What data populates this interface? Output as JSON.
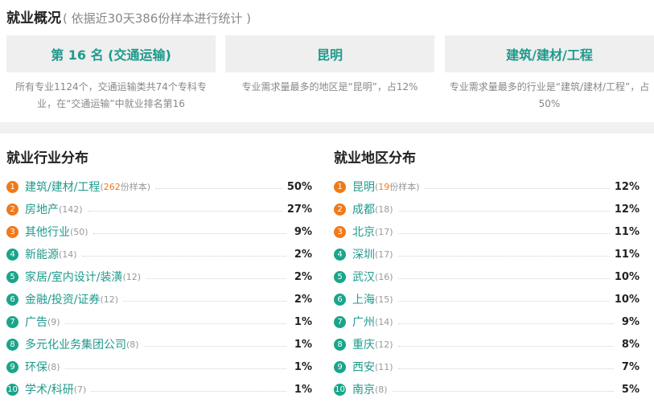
{
  "header": {
    "title": "就业概况",
    "subtitle": "( 依据近30天386份样本进行统计 )"
  },
  "cards": [
    {
      "value": "第 16 名 (交通运输)",
      "desc": "所有专业1124个，交通运输类共74个专科专业，在“交通运输”中就业排名第16"
    },
    {
      "value": "昆明",
      "desc": "专业需求量最多的地区是“昆明”，占12%"
    },
    {
      "value": "建筑/建材/工程",
      "desc": "专业需求量最多的行业是“建筑/建材/工程”，占50%"
    }
  ],
  "industry": {
    "title": "就业行业分布",
    "items": [
      {
        "rank": "1",
        "name": "建筑/建材/工程",
        "count": "262",
        "suffix": "份样本",
        "pct": "50%"
      },
      {
        "rank": "2",
        "name": "房地产",
        "count": "142",
        "suffix": "",
        "pct": "27%"
      },
      {
        "rank": "3",
        "name": "其他行业",
        "count": "50",
        "suffix": "",
        "pct": "9%"
      },
      {
        "rank": "4",
        "name": "新能源",
        "count": "14",
        "suffix": "",
        "pct": "2%"
      },
      {
        "rank": "5",
        "name": "家居/室内设计/装潢",
        "count": "12",
        "suffix": "",
        "pct": "2%"
      },
      {
        "rank": "6",
        "name": "金融/投资/证券",
        "count": "12",
        "suffix": "",
        "pct": "2%"
      },
      {
        "rank": "7",
        "name": "广告",
        "count": "9",
        "suffix": "",
        "pct": "1%"
      },
      {
        "rank": "8",
        "name": "多元化业务集团公司",
        "count": "8",
        "suffix": "",
        "pct": "1%"
      },
      {
        "rank": "9",
        "name": "环保",
        "count": "8",
        "suffix": "",
        "pct": "1%"
      },
      {
        "rank": "10",
        "name": "学术/科研",
        "count": "7",
        "suffix": "",
        "pct": "1%"
      }
    ]
  },
  "region": {
    "title": "就业地区分布",
    "items": [
      {
        "rank": "1",
        "name": "昆明",
        "count": "19",
        "suffix": "份样本",
        "pct": "12%"
      },
      {
        "rank": "2",
        "name": "成都",
        "count": "18",
        "suffix": "",
        "pct": "12%"
      },
      {
        "rank": "3",
        "name": "北京",
        "count": "17",
        "suffix": "",
        "pct": "11%"
      },
      {
        "rank": "4",
        "name": "深圳",
        "count": "17",
        "suffix": "",
        "pct": "11%"
      },
      {
        "rank": "5",
        "name": "武汉",
        "count": "16",
        "suffix": "",
        "pct": "10%"
      },
      {
        "rank": "6",
        "name": "上海",
        "count": "15",
        "suffix": "",
        "pct": "10%"
      },
      {
        "rank": "7",
        "name": "广州",
        "count": "14",
        "suffix": "",
        "pct": "9%"
      },
      {
        "rank": "8",
        "name": "重庆",
        "count": "12",
        "suffix": "",
        "pct": "8%"
      },
      {
        "rank": "9",
        "name": "西安",
        "count": "11",
        "suffix": "",
        "pct": "7%"
      },
      {
        "rank": "10",
        "name": "南京",
        "count": "8",
        "suffix": "",
        "pct": "5%"
      }
    ]
  },
  "colors": {
    "accent": "#1f9a8c",
    "rank_hot": "#f07a1a",
    "rank_cool": "#1aa58a"
  }
}
